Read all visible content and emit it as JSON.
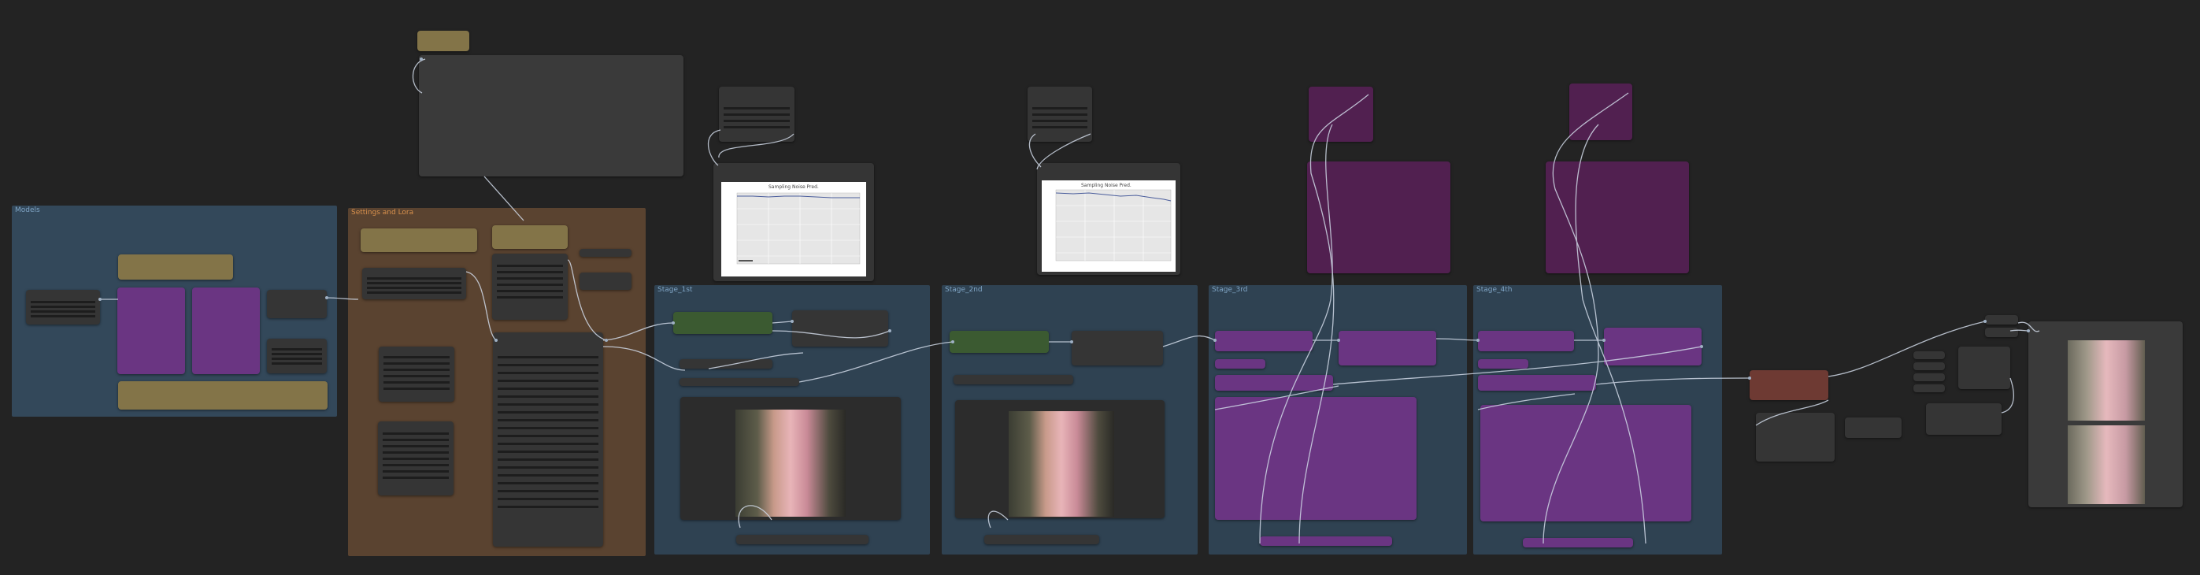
{
  "canvas": {
    "background": "#232323"
  },
  "groups": [
    {
      "id": "g1",
      "title": "Models",
      "color": "#33485a"
    },
    {
      "id": "g2",
      "title": "Settings and Lora",
      "color": "#5a4330"
    },
    {
      "id": "g3",
      "title": "Stage_1st",
      "color": "#2f4252"
    },
    {
      "id": "g4",
      "title": "Stage_2nd",
      "color": "#2f4252"
    },
    {
      "id": "g5",
      "title": "Stage_3rd",
      "color": "#2f4252"
    },
    {
      "id": "g6",
      "title": "Stage_4th",
      "color": "#2f4252"
    }
  ],
  "charts": [
    {
      "id": "chart-1",
      "title": "Sampling Noise Pred."
    },
    {
      "id": "chart-2",
      "title": "Sampling Noise Pred."
    }
  ],
  "colors": {
    "wire": "#cfd8e6",
    "node": "#353535",
    "node_yellow": "#837448",
    "node_purple": "#6a3582",
    "node_green": "#3b5a31",
    "node_red": "#6e3a33"
  },
  "icons": [
    "portrait-thumbnail"
  ]
}
